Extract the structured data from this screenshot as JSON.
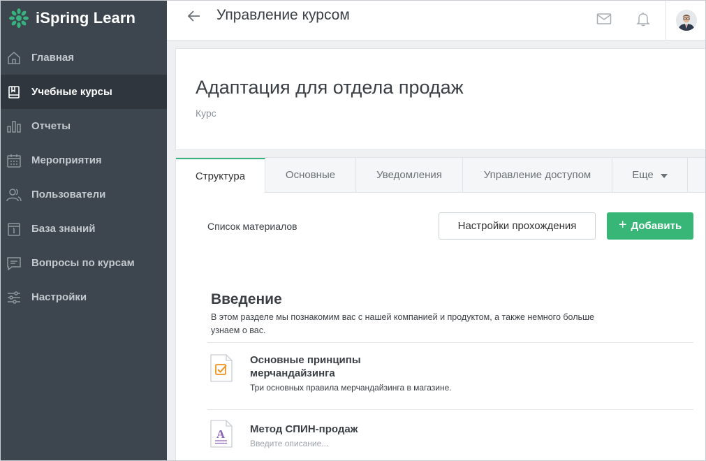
{
  "app": {
    "name": "iSpring Learn",
    "brand_color": "#36b37e"
  },
  "sidebar": {
    "items": [
      {
        "label": "Главная",
        "icon": "home-icon"
      },
      {
        "label": "Учебные курсы",
        "icon": "book-icon",
        "active": true
      },
      {
        "label": "Отчеты",
        "icon": "bar-chart-icon"
      },
      {
        "label": "Мероприятия",
        "icon": "calendar-icon"
      },
      {
        "label": "Пользователи",
        "icon": "users-icon"
      },
      {
        "label": "База знаний",
        "icon": "knowledge-base-icon"
      },
      {
        "label": "Вопросы по курсам",
        "icon": "chat-icon"
      },
      {
        "label": "Настройки",
        "icon": "sliders-icon"
      }
    ]
  },
  "header": {
    "title": "Управление курсом"
  },
  "course": {
    "title": "Адаптация для отдела продаж",
    "type": "Курс"
  },
  "tabs": [
    {
      "label": "Структура",
      "active": true
    },
    {
      "label": "Основные"
    },
    {
      "label": "Уведомления"
    },
    {
      "label": "Управление доступом"
    },
    {
      "label": "Еще"
    }
  ],
  "materials": {
    "list_label": "Список материалов",
    "settings_button": "Настройки прохождения",
    "add_button": "Добавить"
  },
  "section": {
    "title": "Введение",
    "description": "В этом разделе мы познакомим вас с нашей компанией и продуктом, а также немного больше узнаем о вас."
  },
  "items": [
    {
      "title": "Основные принципы мерчандайзинга",
      "description": "Три основных правила мерчандайзинга в магазине.",
      "icon": "quiz-icon"
    },
    {
      "title": "Метод СПИН-продаж",
      "description": "Введите описание...",
      "icon": "text-document-icon"
    }
  ]
}
